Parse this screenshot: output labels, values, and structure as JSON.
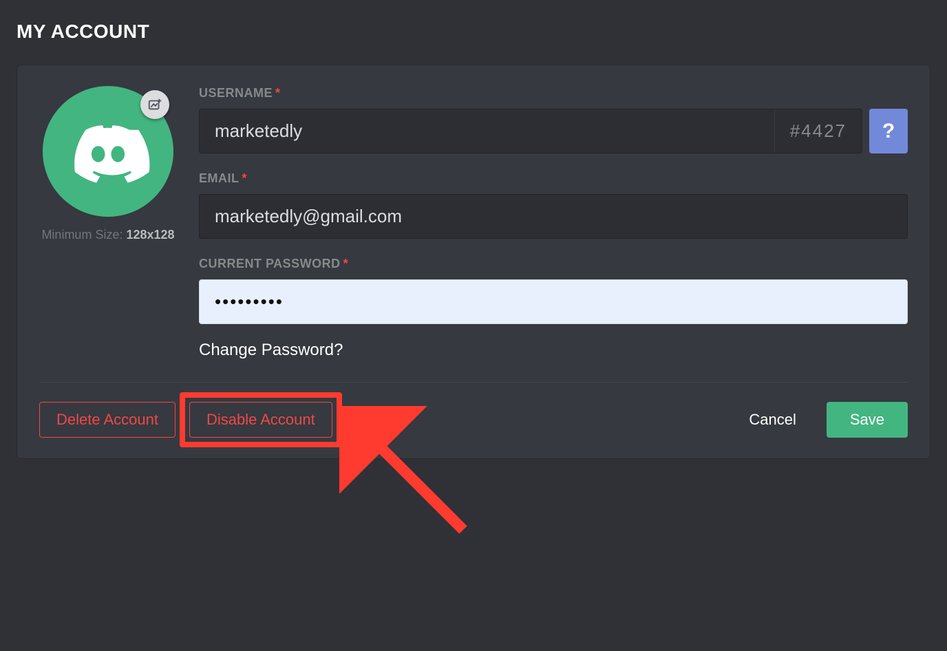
{
  "page": {
    "title": "MY ACCOUNT"
  },
  "avatar": {
    "min_size_label": "Minimum Size:",
    "min_size_value": "128x128"
  },
  "fields": {
    "username_label": "USERNAME",
    "username_value": "marketedly",
    "discriminator": "#4427",
    "help_label": "?",
    "email_label": "EMAIL",
    "email_value": "marketedly@gmail.com",
    "password_label": "CURRENT PASSWORD",
    "password_value": "•••••••••",
    "change_password": "Change Password?"
  },
  "buttons": {
    "delete": "Delete Account",
    "disable": "Disable Account",
    "cancel": "Cancel",
    "save": "Save"
  },
  "colors": {
    "brand_green": "#43b581",
    "blurple": "#7289da",
    "danger": "#f04747",
    "annotation": "#ff3b30"
  },
  "annotation": {
    "target": "disable-account-button"
  }
}
